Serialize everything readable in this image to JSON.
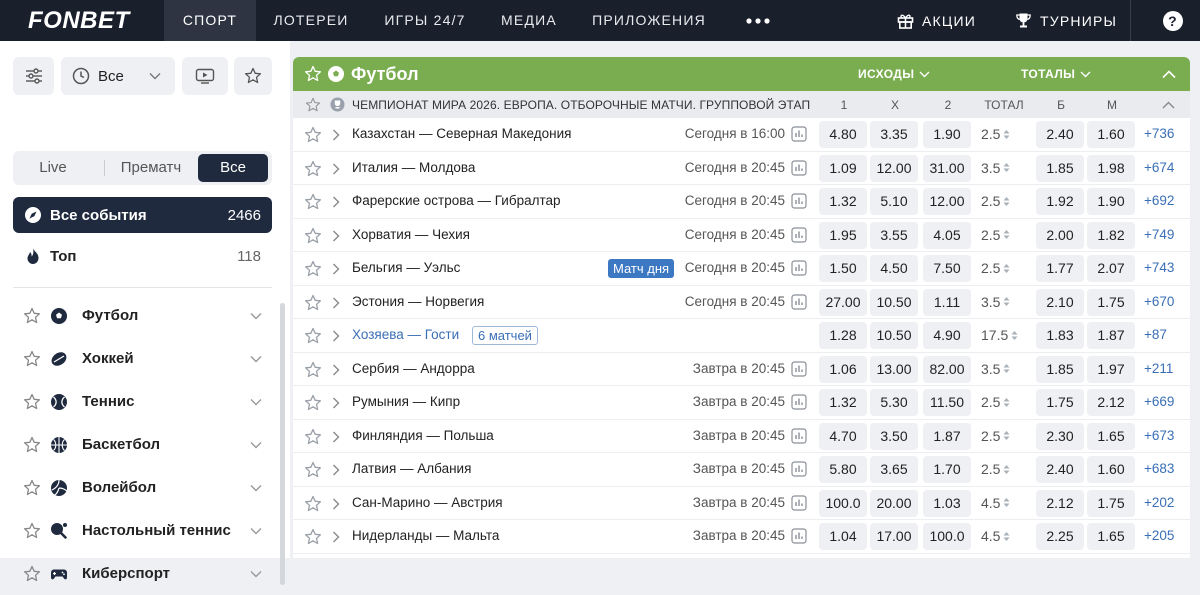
{
  "header": {
    "logo": "FONBET",
    "nav": [
      "СПОРТ",
      "ЛОТЕРЕИ",
      "ИГРЫ 24/7",
      "МЕДИА",
      "ПРИЛОЖЕНИЯ"
    ],
    "more_icon": "ellipsis-icon",
    "right": {
      "actions": "АКЦИИ",
      "tournaments": "ТУРНИРЫ"
    }
  },
  "sidebar": {
    "time_filter": "Все",
    "segments": [
      "Live",
      "Прематч",
      "Все"
    ],
    "all_events": {
      "label": "Все события",
      "count": "2466"
    },
    "top": {
      "label": "Топ",
      "count": "118"
    },
    "sports": [
      {
        "name": "Футбол",
        "icon": "football-icon"
      },
      {
        "name": "Хоккей",
        "icon": "hockey-icon"
      },
      {
        "name": "Теннис",
        "icon": "tennis-icon"
      },
      {
        "name": "Баскетбол",
        "icon": "basketball-icon"
      },
      {
        "name": "Волейбол",
        "icon": "volleyball-icon"
      },
      {
        "name": "Настольный теннис",
        "icon": "table-tennis-icon"
      },
      {
        "name": "Киберспорт",
        "icon": "esports-icon"
      }
    ]
  },
  "main": {
    "sport_title": "Футбол",
    "outcomes_label": "ИСХОДЫ",
    "totals_label": "ТОТАЛЫ",
    "championship": "ЧЕМПИОНАТ МИРА 2026. ЕВРОПА. ОТБОРОЧНЫЕ МАТЧИ. ГРУППОВОЙ ЭТАП",
    "columns": [
      "1",
      "X",
      "2",
      "ТОТАЛ",
      "Б",
      "М"
    ],
    "events": [
      {
        "name": "Казахстан — Северная Македония",
        "time": "Сегодня в 16:00",
        "o1": "4.80",
        "x": "3.35",
        "o2": "1.90",
        "total": "2.5",
        "over": "2.40",
        "under": "1.60",
        "more": "+736"
      },
      {
        "name": "Италия — Молдова",
        "time": "Сегодня в 20:45",
        "o1": "1.09",
        "x": "12.00",
        "o2": "31.00",
        "total": "3.5",
        "over": "1.85",
        "under": "1.98",
        "more": "+674"
      },
      {
        "name": "Фарерские острова — Гибралтар",
        "time": "Сегодня в 20:45",
        "o1": "1.32",
        "x": "5.10",
        "o2": "12.00",
        "total": "2.5",
        "over": "1.92",
        "under": "1.90",
        "more": "+692"
      },
      {
        "name": "Хорватия — Чехия",
        "time": "Сегодня в 20:45",
        "o1": "1.95",
        "x": "3.55",
        "o2": "4.05",
        "total": "2.5",
        "over": "2.00",
        "under": "1.82",
        "more": "+749"
      },
      {
        "name": "Бельгия — Уэльс",
        "badge": "Матч дня",
        "time": "Сегодня в 20:45",
        "o1": "1.50",
        "x": "4.50",
        "o2": "7.50",
        "total": "2.5",
        "over": "1.77",
        "under": "2.07",
        "more": "+743"
      },
      {
        "name": "Эстония — Норвегия",
        "time": "Сегодня в 20:45",
        "o1": "27.00",
        "x": "10.50",
        "o2": "1.11",
        "total": "3.5",
        "over": "2.10",
        "under": "1.75",
        "more": "+670"
      },
      {
        "name": "Хозяева — Гости",
        "badge": "6 матчей",
        "time": "",
        "o1": "1.28",
        "x": "10.50",
        "o2": "4.90",
        "total": "17.5",
        "over": "1.83",
        "under": "1.87",
        "more": "+87"
      },
      {
        "name": "Сербия — Андорра",
        "time": "Завтра в 20:45",
        "o1": "1.06",
        "x": "13.00",
        "o2": "82.00",
        "total": "3.5",
        "over": "1.85",
        "under": "1.97",
        "more": "+211"
      },
      {
        "name": "Румыния — Кипр",
        "time": "Завтра в 20:45",
        "o1": "1.32",
        "x": "5.30",
        "o2": "11.50",
        "total": "2.5",
        "over": "1.75",
        "under": "2.12",
        "more": "+669"
      },
      {
        "name": "Финляндия — Польша",
        "time": "Завтра в 20:45",
        "o1": "4.70",
        "x": "3.50",
        "o2": "1.87",
        "total": "2.5",
        "over": "2.30",
        "under": "1.65",
        "more": "+673"
      },
      {
        "name": "Латвия — Албания",
        "time": "Завтра в 20:45",
        "o1": "5.80",
        "x": "3.65",
        "o2": "1.70",
        "total": "2.5",
        "over": "2.40",
        "under": "1.60",
        "more": "+683"
      },
      {
        "name": "Сан-Марино — Австрия",
        "time": "Завтра в 20:45",
        "o1": "100.0",
        "x": "20.00",
        "o2": "1.03",
        "total": "4.5",
        "over": "2.12",
        "under": "1.75",
        "more": "+202"
      },
      {
        "name": "Нидерланды — Мальта",
        "time": "Завтра в 20:45",
        "o1": "1.04",
        "x": "17.00",
        "o2": "100.0",
        "total": "4.5",
        "over": "2.25",
        "under": "1.65",
        "more": "+205"
      }
    ]
  },
  "colors": {
    "topbar": "#1a1f2c",
    "sport_header": "#79ad4f",
    "active_dark": "#1f2a3f",
    "link_blue": "#3a6fb6",
    "badge_blue": "#3d78c3"
  }
}
